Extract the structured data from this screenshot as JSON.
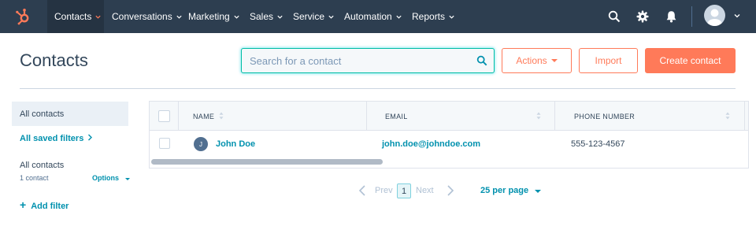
{
  "nav": {
    "items": [
      {
        "label": "Contacts"
      },
      {
        "label": "Conversations"
      },
      {
        "label": "Marketing"
      },
      {
        "label": "Sales"
      },
      {
        "label": "Service"
      },
      {
        "label": "Automation"
      },
      {
        "label": "Reports"
      }
    ],
    "icons": [
      "search-icon",
      "gear-icon",
      "bell-icon",
      "user-avatar",
      "chevron-down-icon"
    ],
    "accent": "#ff7a59",
    "background": "#2d3e50"
  },
  "header": {
    "title": "Contacts",
    "search_placeholder": "Search for a contact",
    "actions_label": "Actions",
    "import_label": "Import",
    "create_label": "Create contact"
  },
  "sidebar": {
    "all_contacts": "All contacts",
    "saved_filters": "All saved filters",
    "view_title": "All contacts",
    "count": "1 contact",
    "options": "Options",
    "add_filter": "Add filter"
  },
  "table": {
    "columns": [
      "NAME",
      "EMAIL",
      "PHONE NUMBER"
    ],
    "rows": [
      {
        "initial": "J",
        "name": "John Doe",
        "email": "john.doe@johndoe.com",
        "phone": "555-123-4567"
      }
    ]
  },
  "pagination": {
    "prev": "Prev",
    "current": "1",
    "next": "Next",
    "per_page": "25 per page"
  }
}
